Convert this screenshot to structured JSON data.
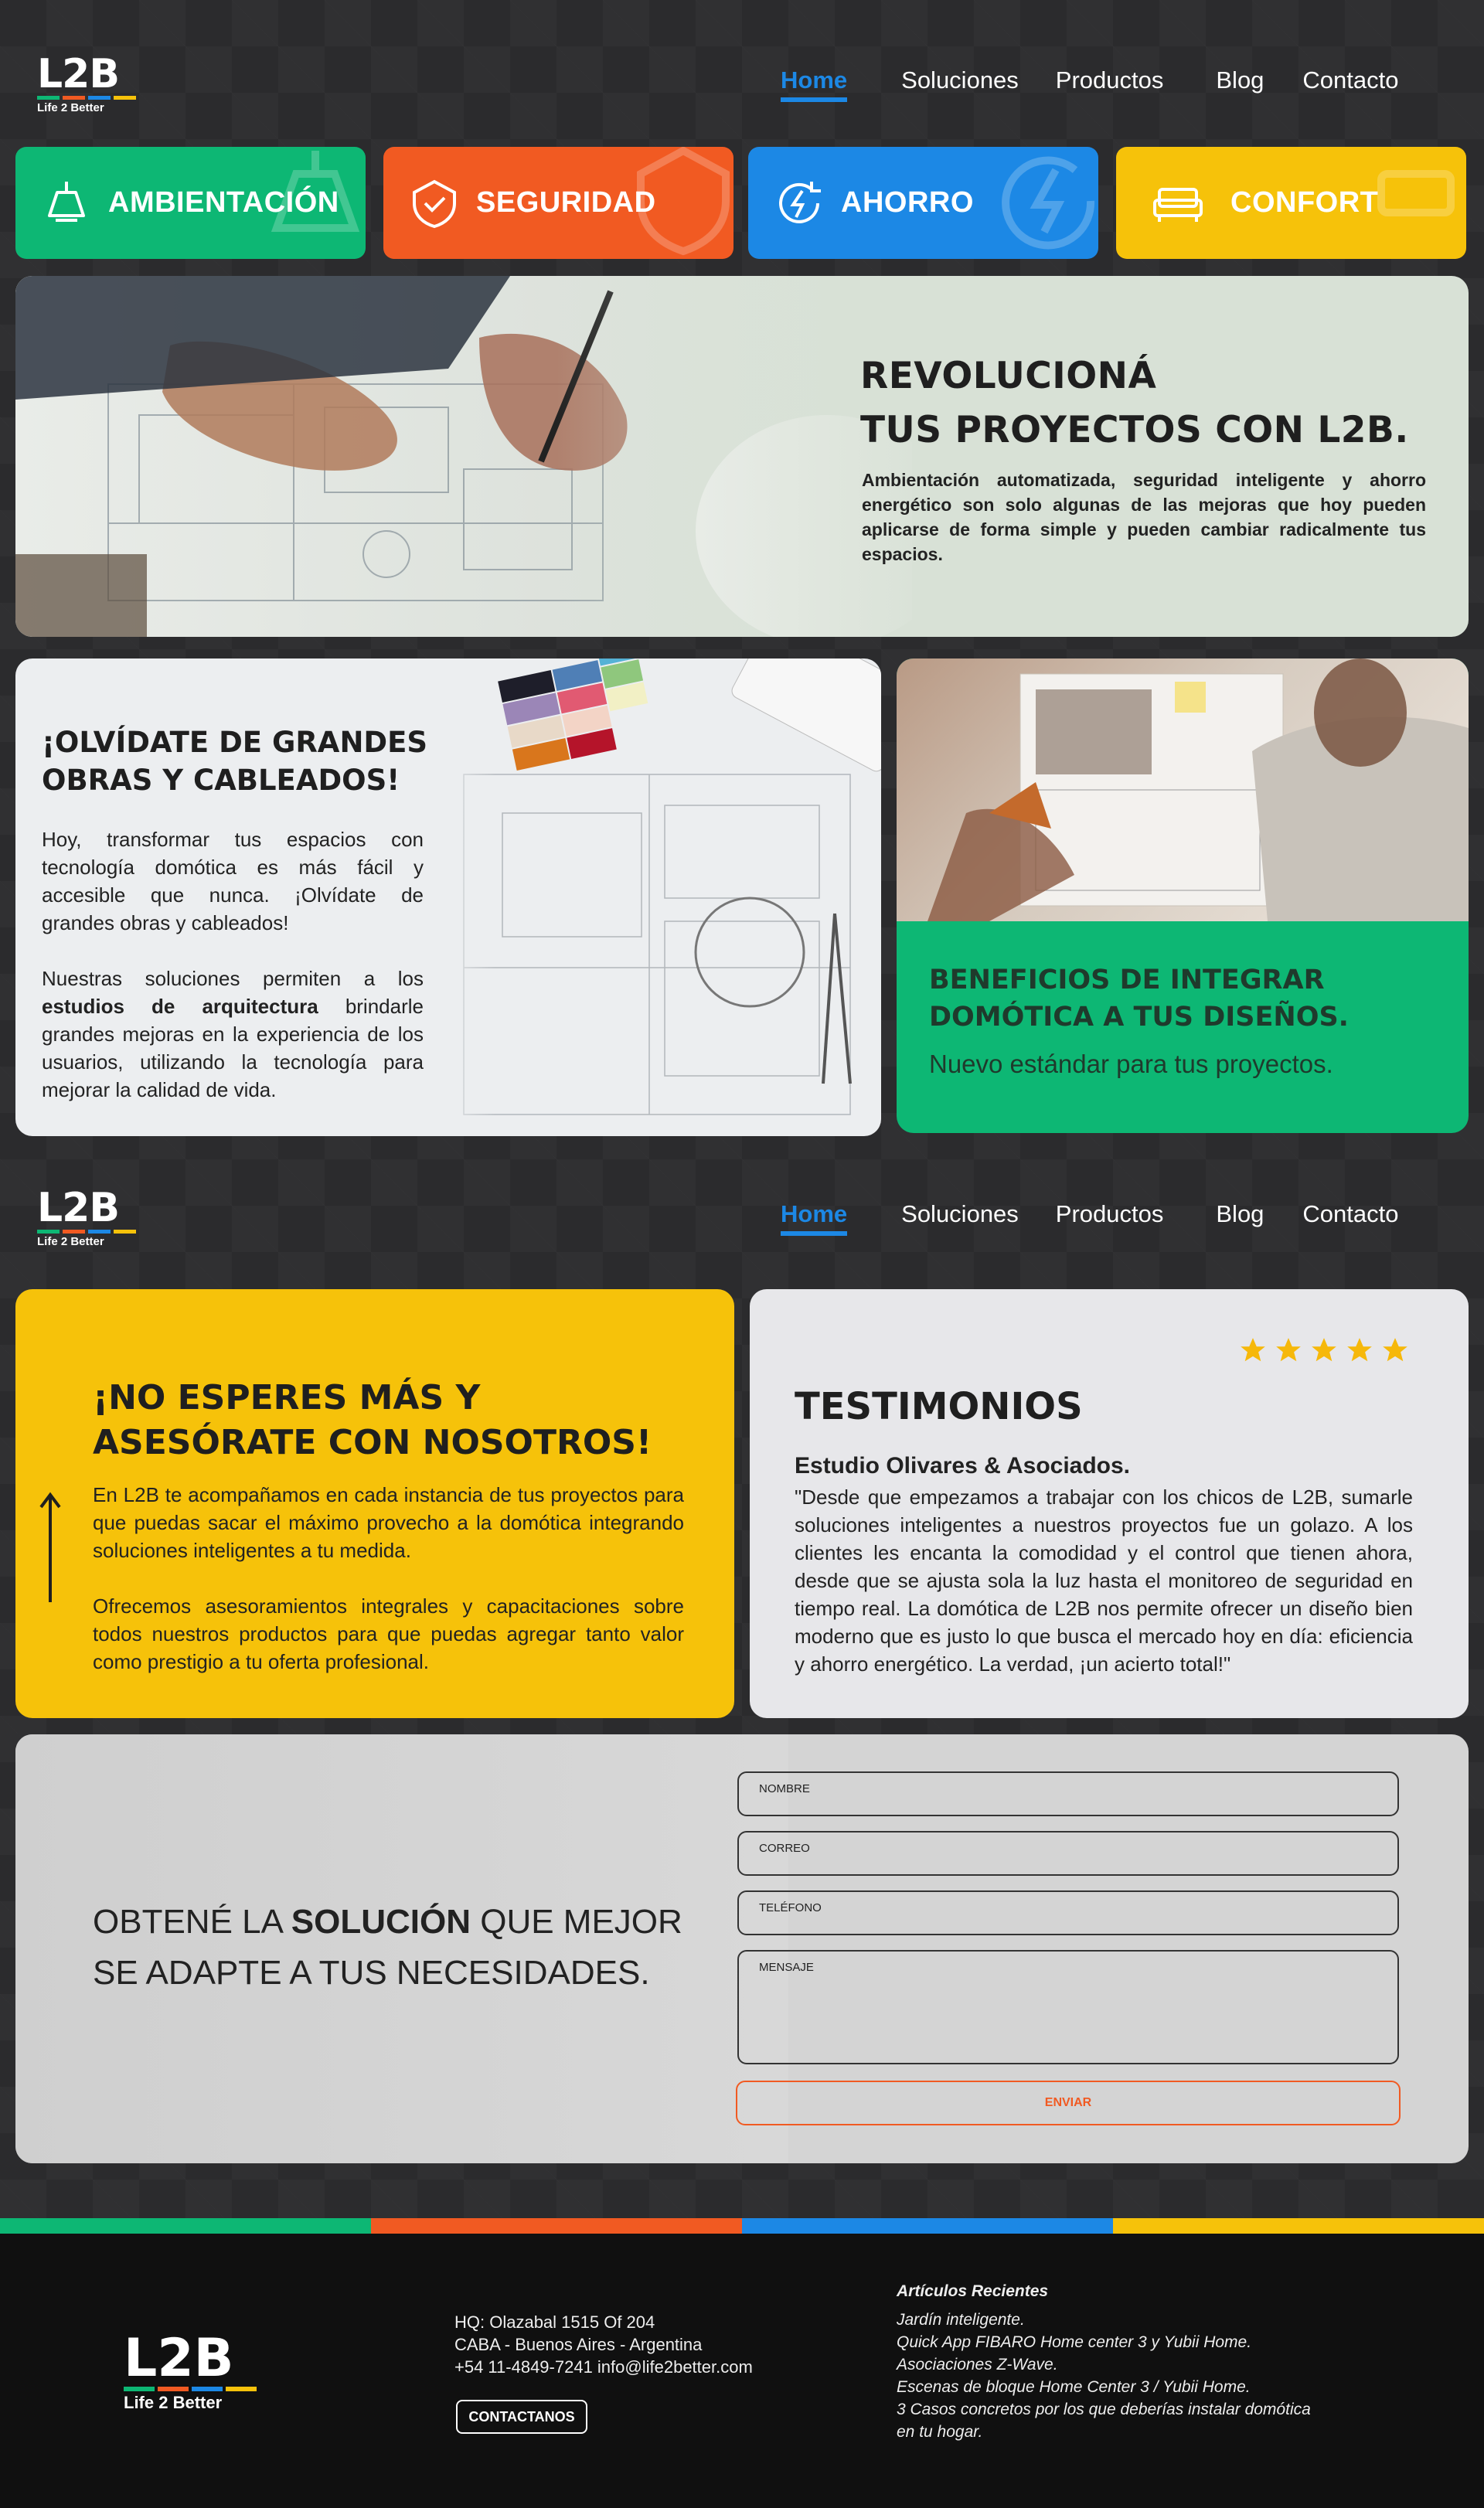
{
  "brand": {
    "mark": "L2B",
    "tagline": "Life 2 Better",
    "colors": [
      "#0db774",
      "#f15a22",
      "#1c88e5",
      "#f6c20a"
    ]
  },
  "nav": [
    "Home",
    "Soluciones",
    "Productos",
    "Blog",
    "Contacto"
  ],
  "categories": [
    {
      "label": "AMBIENTACIÓN",
      "color": "#0db774",
      "icon": "lamp-icon"
    },
    {
      "label": "SEGURIDAD",
      "color": "#f15a22",
      "icon": "shield-icon"
    },
    {
      "label": "AHORRO",
      "color": "#1c88e5",
      "icon": "energy-icon"
    },
    {
      "label": "CONFORT",
      "color": "#f6c20a",
      "icon": "sofa-icon"
    }
  ],
  "hero": {
    "title_l1": "REVOLUCIONÁ",
    "title_l2": "TUS PROYECTOS CON L2B.",
    "text": "Ambientación automatizada, seguridad inteligente y ahorro energético son solo algunas de las mejoras que hoy pueden aplicarse de forma simple y pueden cambiar radicalmente tus espacios."
  },
  "obras": {
    "title_l1": "¡OLVÍDATE DE GRANDES",
    "title_l2": "OBRAS Y CABLEADOS!",
    "p1": "Hoy, transformar tus espacios con tecnología domótica es más fácil y accesible que nunca. ¡Olvídate de grandes obras y cableados!",
    "p2_pre": "Nuestras soluciones permiten a los ",
    "p2_bold": "estudios de arquitectura",
    "p2_post": " brindarle grandes mejoras en la experiencia de los usuarios, utilizando la tecnología para mejorar la calidad de vida."
  },
  "beneficios": {
    "title_l1": "BENEFICIOS DE INTEGRAR",
    "title_l2": "DOMÓTICA A TUS DISEÑOS.",
    "sub": "Nuevo estándar para tus proyectos."
  },
  "asesorate": {
    "title_l1": "¡NO ESPERES MÁS Y",
    "title_l2": "ASESÓRATE CON NOSOTROS!",
    "p1": "En L2B te acompañamos en cada instancia de tus proyectos para que puedas sacar el máximo provecho a la domótica integrando soluciones inteligentes a tu medida.",
    "p2": "Ofrecemos asesoramientos integrales y capacitaciones sobre todos nuestros productos para que puedas agregar tanto valor como prestigio a tu oferta profesional."
  },
  "testimonios": {
    "title": "TESTIMONIOS",
    "rating": 5,
    "author": "Estudio Olivares & Asociados.",
    "quote": "\"Desde que empezamos a trabajar con los chicos de L2B, sumarle soluciones inteligentes a nuestros proyectos fue un golazo. A los clientes les encanta la comodidad y el control que tienen ahora, desde que se ajusta sola la luz hasta el monitoreo de seguridad en tiempo real. La domótica de L2B nos permite ofrecer un diseño bien moderno que es justo lo que busca el mercado hoy en día: eficiencia y ahorro energético. La verdad, ¡un acierto total!\""
  },
  "contact": {
    "heading_pre": "OBTENÉ LA ",
    "heading_bold": "SOLUCIÓN",
    "heading_post": " QUE MEJOR SE ADAPTE A TUS NECESIDADES.",
    "fields": [
      "NOMBRE",
      "CORREO",
      "TELÉFONO",
      "MENSAJE"
    ],
    "submit": "ENVIAR"
  },
  "footer": {
    "address_l1": "HQ: Olazabal 1515 Of 204",
    "address_l2": "CABA - Buenos Aires - Argentina",
    "contact_line": "+54 11-4849-7241 info@life2better.com",
    "button": "CONTACTANOS",
    "articles_title": "Artículos Recientes",
    "articles": [
      "Jardín inteligente.",
      "Quick App FIBARO Home center 3 y Yubii Home.",
      "Asociaciones Z-Wave.",
      "Escenas de bloque Home Center 3 / Yubii Home.",
      "3 Casos concretos por los que deberías instalar domótica en tu hogar."
    ]
  }
}
